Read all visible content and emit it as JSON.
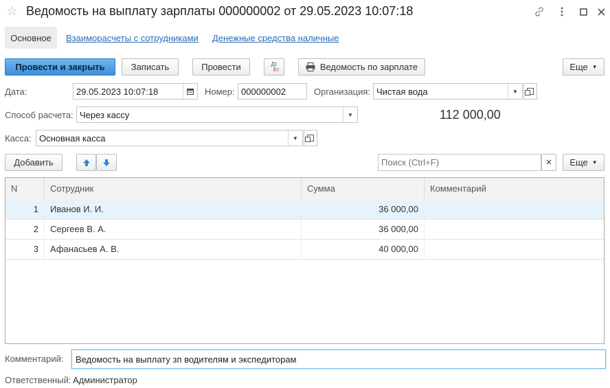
{
  "window": {
    "title": "Ведомость на выплату зарплаты 000000002 от 29.05.2023 10:07:18",
    "icons": [
      "star-icon",
      "link-icon",
      "more-vertical-icon",
      "maximize-icon",
      "close-icon"
    ]
  },
  "tabs": [
    {
      "label": "Основное"
    },
    {
      "label": "Взаиморасчеты с сотрудниками"
    },
    {
      "label": "Денежные средства наличные"
    }
  ],
  "toolbar": {
    "post_close": "Провести и закрыть",
    "save": "Записать",
    "post": "Провести",
    "dt_kt_top": "Дт",
    "dt_kt_bottom": "Кт",
    "print_report": "Ведомость по зарплате",
    "more": "Еще"
  },
  "form": {
    "date_label": "Дата:",
    "date_value": "29.05.2023 10:07:18",
    "number_label": "Номер:",
    "number_value": "000000002",
    "org_label": "Организация:",
    "org_value": "Чистая вода",
    "payment_method_label": "Способ расчета:",
    "payment_method_value": "Через кассу",
    "cashbox_label": "Касса:",
    "cashbox_value": "Основная касса",
    "total": "112 000,00"
  },
  "table_toolbar": {
    "add": "Добавить",
    "search_placeholder": "Поиск (Ctrl+F)",
    "clear": "×",
    "more": "Еще"
  },
  "table": {
    "columns": [
      "N",
      "Сотрудник",
      "Сумма",
      "Комментарий"
    ],
    "rows": [
      {
        "n": "1",
        "employee": "Иванов И. И.",
        "amount": "36 000,00",
        "comment": ""
      },
      {
        "n": "2",
        "employee": "Сергеев В. А.",
        "amount": "36 000,00",
        "comment": ""
      },
      {
        "n": "3",
        "employee": "Афанасьев А. В.",
        "amount": "40 000,00",
        "comment": ""
      }
    ]
  },
  "footer": {
    "comment_label": "Комментарий:",
    "comment_value": "Ведомость на выплату зп водителям и экспедиторам",
    "responsible_label": "Ответственный:",
    "responsible_value": "Администратор"
  }
}
